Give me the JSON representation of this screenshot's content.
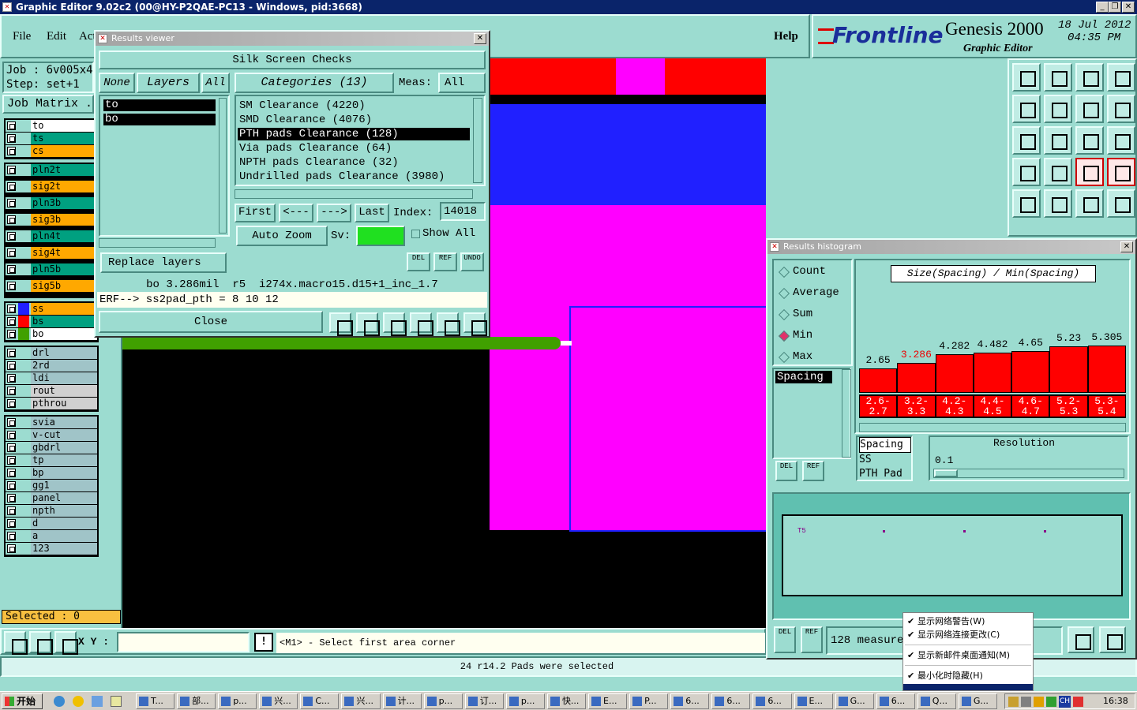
{
  "window": {
    "title": "Graphic Editor 9.02c2 (00@HY-P2QAE-PC13 - Windows, pid:3668)"
  },
  "menu": {
    "file": "File",
    "edit": "Edit",
    "actions": "Act",
    "help": "Help"
  },
  "brand": {
    "logo": "Frontline",
    "product": "Genesis 2000",
    "subtitle": "Graphic Editor",
    "date": "18 Jul 2012",
    "time": "04:35 PM"
  },
  "job": {
    "job_label": "Job : 6v005x4",
    "step_label": "Step: set+1",
    "matrix_button": "Job Matrix ."
  },
  "layers": [
    {
      "name": "to",
      "color": "#ffffff",
      "swatch": "#9cdcd0"
    },
    {
      "name": "ts",
      "color": "#00a080",
      "swatch": "#9cdcd0"
    },
    {
      "name": "cs",
      "color": "#ffa800",
      "swatch": "#9cdcd0"
    },
    {
      "name": "pln2t",
      "color": "#00a080",
      "swatch": "#9cdcd0"
    },
    {
      "name": "sig2t",
      "color": "#ffa800",
      "swatch": "#9cdcd0"
    },
    {
      "name": "pln3b",
      "color": "#00a080",
      "swatch": "#9cdcd0"
    },
    {
      "name": "sig3b",
      "color": "#ffa800",
      "swatch": "#9cdcd0"
    },
    {
      "name": "pln4t",
      "color": "#00a080",
      "swatch": "#9cdcd0"
    },
    {
      "name": "sig4t",
      "color": "#ffa800",
      "swatch": "#9cdcd0"
    },
    {
      "name": "pln5b",
      "color": "#00a080",
      "swatch": "#9cdcd0"
    },
    {
      "name": "sig5b",
      "color": "#ffa800",
      "swatch": "#9cdcd0"
    },
    {
      "name": "ss",
      "color": "#ffa800",
      "swatch": "#2020ff"
    },
    {
      "name": "bs",
      "color": "#00a080",
      "swatch": "#ff0000"
    },
    {
      "name": "bo",
      "color": "#ffffff",
      "swatch": "#40a000"
    },
    {
      "name": "drl",
      "color": "#a0c4c8",
      "swatch": "#9cdcd0"
    },
    {
      "name": "2rd",
      "color": "#a0c4c8",
      "swatch": "#9cdcd0"
    },
    {
      "name": "ldi",
      "color": "#a0c4c8",
      "swatch": "#9cdcd0"
    },
    {
      "name": "rout",
      "color": "#d0d0d0",
      "swatch": "#9cdcd0"
    },
    {
      "name": "pthrou",
      "color": "#d0d0d0",
      "swatch": "#9cdcd0"
    },
    {
      "name": "svia",
      "color": "#a0c4c8",
      "swatch": "#9cdcd0"
    },
    {
      "name": "v-cut",
      "color": "#a0c4c8",
      "swatch": "#9cdcd0"
    },
    {
      "name": "gbdrl",
      "color": "#a0c4c8",
      "swatch": "#9cdcd0"
    },
    {
      "name": "tp",
      "color": "#a0c4c8",
      "swatch": "#9cdcd0"
    },
    {
      "name": "bp",
      "color": "#a0c4c8",
      "swatch": "#9cdcd0"
    },
    {
      "name": "gg1",
      "color": "#a0c4c8",
      "swatch": "#9cdcd0"
    },
    {
      "name": "panel",
      "color": "#a0c4c8",
      "swatch": "#9cdcd0"
    },
    {
      "name": "npth",
      "color": "#a0c4c8",
      "swatch": "#9cdcd0"
    },
    {
      "name": "d",
      "color": "#a0c4c8",
      "swatch": "#9cdcd0"
    },
    {
      "name": "a",
      "color": "#a0c4c8",
      "swatch": "#9cdcd0"
    },
    {
      "name": "123",
      "color": "#a0c4c8",
      "swatch": "#9cdcd0"
    }
  ],
  "selected_status": "Selected : 0",
  "coord": {
    "label": "X Y :",
    "value": ""
  },
  "prompt_text": "<M1> - Select first area corner",
  "status_bar": "24 r14.2 Pads were selected",
  "results_viewer": {
    "title": "Results viewer",
    "header": "Silk Screen Checks",
    "none_btn": "None",
    "layers_btn": "Layers",
    "all_btn": "All",
    "categories_btn": "Categories (13)",
    "meas_label": "Meas:",
    "meas_value": "All",
    "layer_list": [
      "to",
      "bo"
    ],
    "categories": [
      "SM Clearance (4220)",
      "SMD Clearance (4076)",
      "PTH pads Clearance (128)",
      "Via pads Clearance (64)",
      "NPTH pads Clearance (32)",
      "Undrilled pads Clearance (3980)"
    ],
    "selected_category": 2,
    "first_btn": "First",
    "prev_btn": "<---",
    "next_btn": "--->",
    "last_btn": "Last",
    "index_label": "Index:",
    "index_value": "14018",
    "auto_zoom": "Auto Zoom",
    "sv_label": "Sv:",
    "show_all": "Show All",
    "del": "DEL",
    "ref": "REF",
    "undo": "UNDO",
    "replace_layers": "Replace layers",
    "info_line": "bo 3.286mil  r5  i274x.macro15.d15+1_inc_1.7",
    "erf_line": "ERF--> ss2pad_pth = 8 10 12",
    "close_btn": "Close"
  },
  "histogram": {
    "title": "Results histogram",
    "modes": [
      "Count",
      "Average",
      "Sum",
      "Min",
      "Max"
    ],
    "selected_mode": "Min",
    "chart_title": "Size(Spacing) / Min(Spacing)",
    "left_list": [
      "Spacing"
    ],
    "bar_values": [
      2.65,
      3.286,
      4.282,
      4.482,
      4.65,
      5.23,
      5.305
    ],
    "bar_labels": [
      "2.65",
      "3.286",
      "4.282",
      "4.482",
      "4.65",
      "5.23",
      "5.305"
    ],
    "highlight_index": 1,
    "bins": [
      "2.6-2.7",
      "3.2-3.3",
      "4.2-4.3",
      "4.4-4.5",
      "4.6-4.7",
      "5.2-5.3",
      "5.3-5.4"
    ],
    "meas_list": [
      "Spacing",
      "SS",
      "PTH Pad"
    ],
    "resolution_label": "Resolution",
    "resolution_value": "0.1",
    "del": "DEL",
    "ref": "REF",
    "measure_count": "128 measure",
    "preview_label": "T5"
  },
  "context_menu": [
    "显示网络警告(W)",
    "显示网络连接更改(C)",
    "显示新邮件桌面通知(M)",
    "最小化时隐藏(H)"
  ],
  "taskbar": {
    "start": "开始",
    "items": [
      "T...",
      "部...",
      "p...",
      "兴...",
      "C...",
      "兴...",
      "计...",
      "p...",
      "订...",
      "p...",
      "快...",
      "E...",
      "P...",
      "6...",
      "6...",
      "6...",
      "E...",
      "G...",
      "6...",
      "Q...",
      "G..."
    ],
    "lang": "CH",
    "clock": "16:38"
  }
}
